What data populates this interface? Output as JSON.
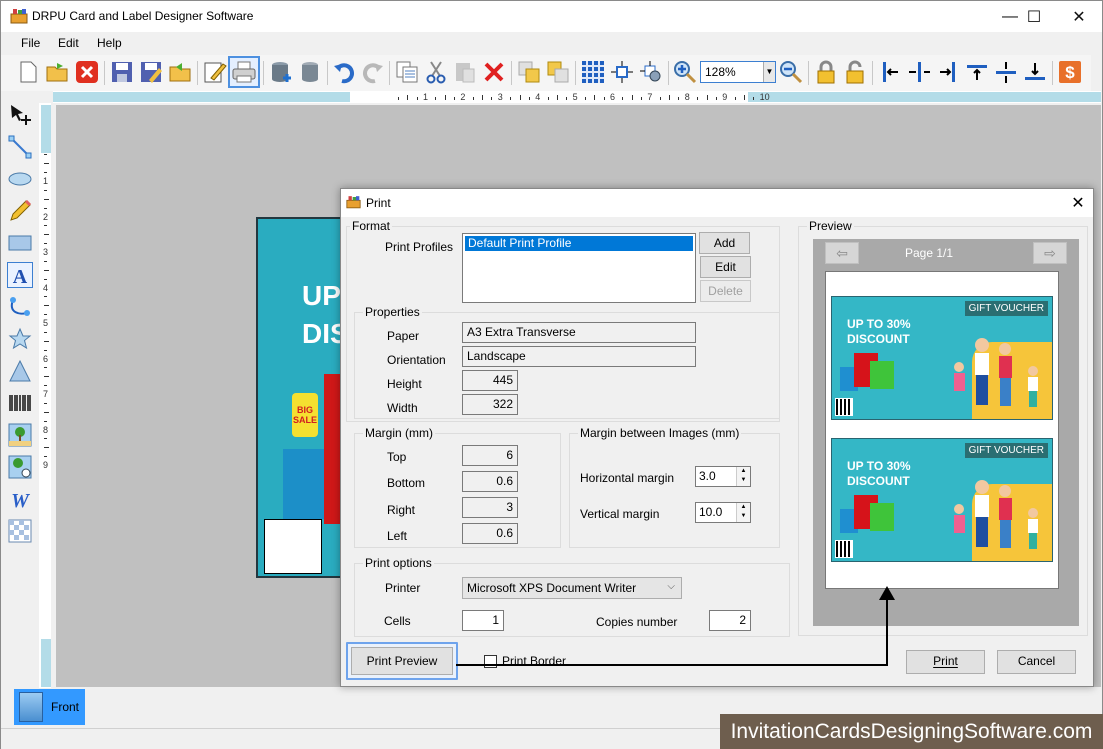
{
  "window": {
    "title": "DRPU Card and Label Designer Software",
    "controls": {
      "minimize": "—",
      "maximize": "☐",
      "close": "✕"
    }
  },
  "menu": {
    "items": [
      "File",
      "Edit",
      "Help"
    ]
  },
  "toolbar": {
    "buttons": [
      "new",
      "open",
      "close",
      "save",
      "save-as",
      "export",
      "edit",
      "print",
      "database-add",
      "database",
      "undo",
      "redo",
      "copy",
      "cut",
      "paste",
      "delete",
      "bring-front",
      "send-back",
      "grid",
      "center",
      "fit",
      "zoom-in",
      "zoom-out",
      "lock",
      "unlock",
      "align-left",
      "align-center",
      "align-right",
      "align-top",
      "align-middle",
      "align-bottom",
      "buy"
    ],
    "zoom_value": "128%"
  },
  "ruler": {
    "horizontal": [
      "1",
      "2",
      "3",
      "4",
      "5",
      "6",
      "7",
      "8",
      "9",
      "10"
    ],
    "vertical": [
      "1",
      "2",
      "3",
      "4",
      "5",
      "6",
      "7",
      "8",
      "9"
    ]
  },
  "tools": [
    "select",
    "line",
    "ellipse",
    "pencil",
    "rectangle",
    "text",
    "curve",
    "star",
    "triangle",
    "barcode",
    "image",
    "image-library",
    "word-art",
    "pattern"
  ],
  "canvas_card": {
    "text": "UP\nDIS",
    "tag": "BIG SALE"
  },
  "bottom_tabs": [
    {
      "label": "Front",
      "active": true
    }
  ],
  "watermark": "InvitationCardsDesigningSoftware.com",
  "print_dialog": {
    "title": "Print",
    "close": "✕",
    "format": {
      "legend": "Format",
      "profiles_label": "Print Profiles",
      "profiles": [
        "Default Print Profile"
      ],
      "selected_profile": "Default Print Profile",
      "add": "Add",
      "edit": "Edit",
      "delete": "Delete"
    },
    "properties": {
      "legend": "Properties",
      "paper_label": "Paper",
      "paper": "A3 Extra Transverse",
      "orientation_label": "Orientation",
      "orientation": "Landscape",
      "height_label": "Height",
      "height": "445",
      "width_label": "Width",
      "width": "322"
    },
    "margin": {
      "legend": "Margin (mm)",
      "top_label": "Top",
      "top": "6",
      "bottom_label": "Bottom",
      "bottom": "0.6",
      "right_label": "Right",
      "right": "3",
      "left_label": "Left",
      "left": "0.6"
    },
    "margin_between": {
      "legend": "Margin between Images (mm)",
      "horizontal_label": "Horizontal margin",
      "horizontal": "3.0",
      "vertical_label": "Vertical margin",
      "vertical": "10.0"
    },
    "print_options": {
      "legend": "Print options",
      "printer_label": "Printer",
      "printer": "Microsoft XPS Document Writer",
      "cells_label": "Cells",
      "cells": "1",
      "copies_label": "Copies number",
      "copies": "2"
    },
    "print_preview": "Print Preview",
    "print_border": "Print Border",
    "print_border_checked": false,
    "preview": {
      "legend": "Preview",
      "page_label": "Page 1/1",
      "prev": "⇦",
      "next": "⇨",
      "vouchers": [
        {
          "badge": "GIFT VOUCHER",
          "line1": "UP TO 30%",
          "line2": "DISCOUNT"
        },
        {
          "badge": "GIFT VOUCHER",
          "line1": "UP TO 30%",
          "line2": "DISCOUNT"
        }
      ]
    },
    "print": "Print",
    "cancel": "Cancel"
  }
}
